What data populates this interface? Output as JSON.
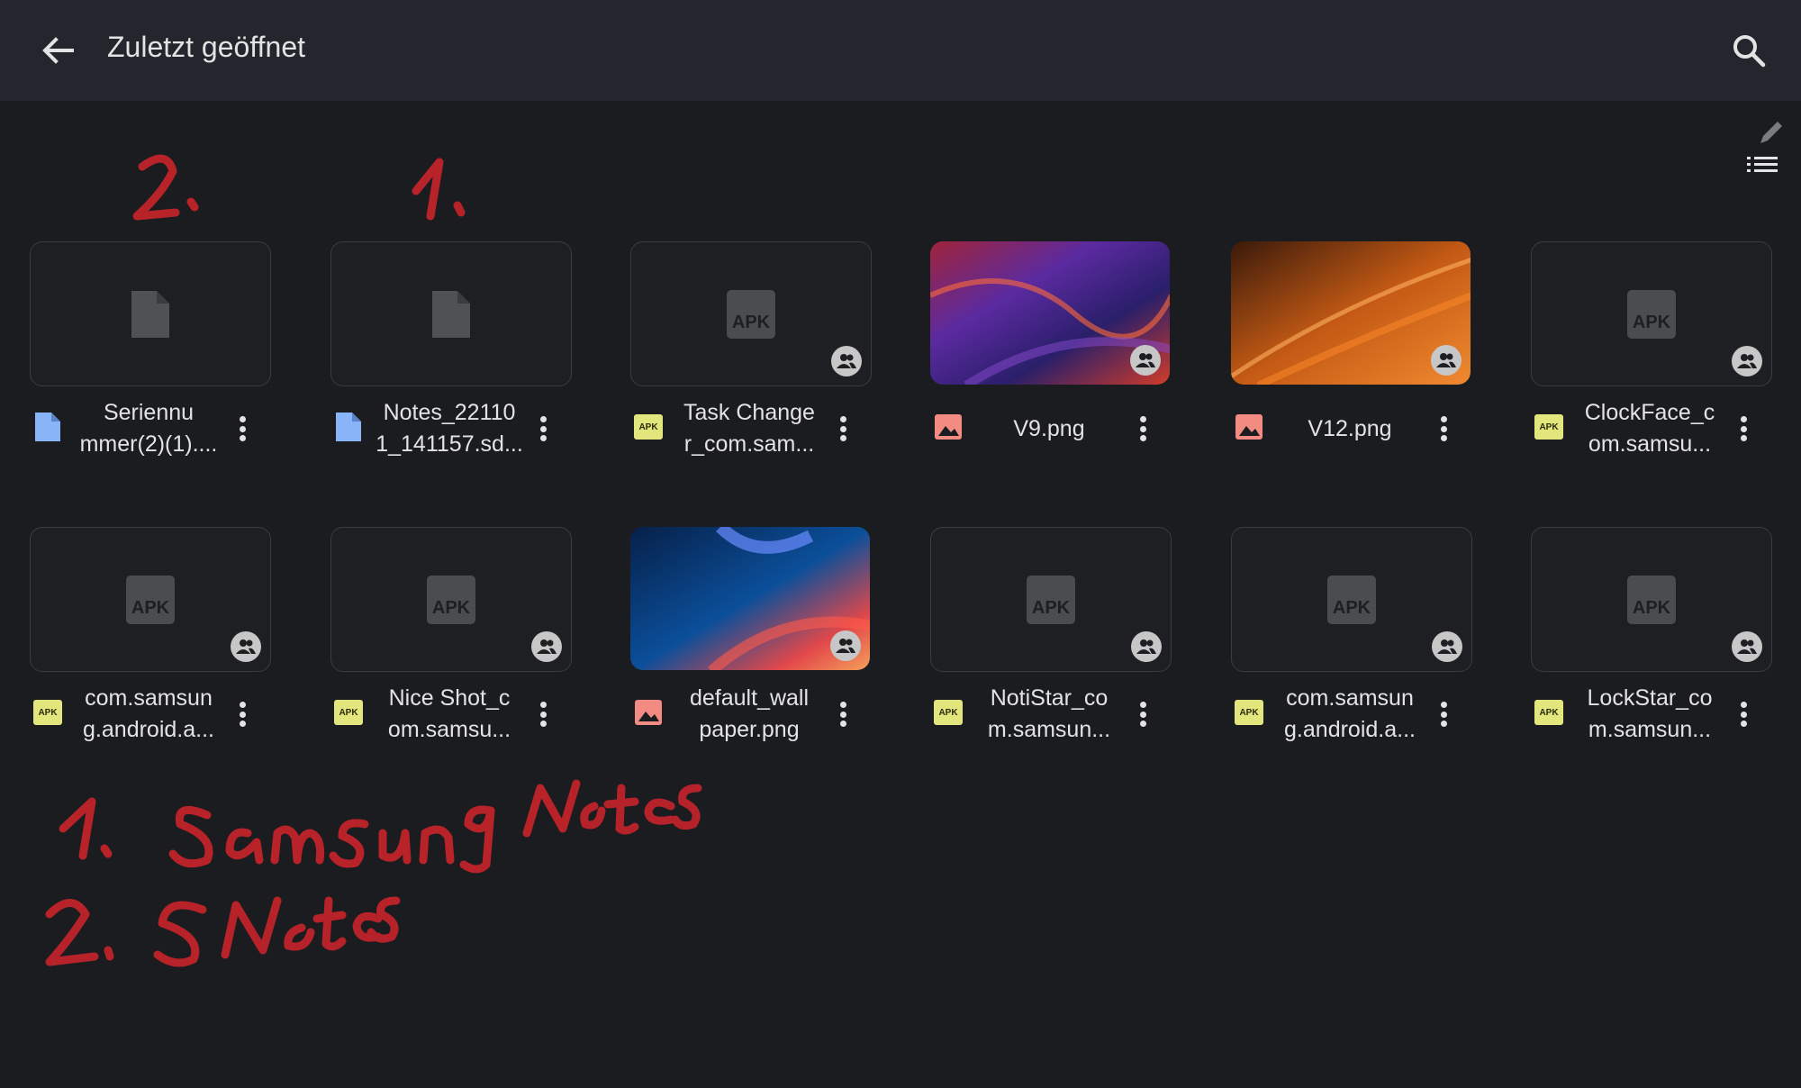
{
  "header": {
    "title": "Zuletzt geöffnet",
    "back_icon": "arrow-back-icon",
    "search_icon": "search-icon",
    "list_view_icon": "list-view-icon",
    "edit_icon": "pencil-icon"
  },
  "files": [
    {
      "name": "Seriennu mmer(2)(1)....",
      "type": "doc",
      "shared": false
    },
    {
      "name": "Notes_22110 1_141157.sd...",
      "type": "doc",
      "shared": false
    },
    {
      "name": "Task Change r_com.sam...",
      "type": "apk",
      "shared": true
    },
    {
      "name": "V9.png",
      "type": "image",
      "shared": true
    },
    {
      "name": "V12.png",
      "type": "image",
      "shared": true
    },
    {
      "name": "ClockFace_c om.samsu...",
      "type": "apk",
      "shared": true
    },
    {
      "name": "com.samsun g.android.a...",
      "type": "apk",
      "shared": true
    },
    {
      "name": "Nice Shot_c om.samsu...",
      "type": "apk",
      "shared": true
    },
    {
      "name": "default_wall paper.png",
      "type": "image",
      "shared": true
    },
    {
      "name": "NotiStar_co m.samsun...",
      "type": "apk",
      "shared": true
    },
    {
      "name": "com.samsun g.android.a...",
      "type": "apk",
      "shared": true
    },
    {
      "name": "LockStar_co m.samsun...",
      "type": "apk",
      "shared": true
    }
  ],
  "apk_label": "APK",
  "colors": {
    "background": "#1b1c1f",
    "header": "#23262c",
    "doc_icon": "#8ab4f8",
    "image_icon": "#f28b82",
    "apk_badge": "#e2e67c",
    "annotation": "#d92626"
  },
  "handwriting": {
    "mark_2": "2.",
    "mark_1": "1.",
    "line_1": "1. Samsung Notes",
    "line_2": "2. SNotes"
  }
}
